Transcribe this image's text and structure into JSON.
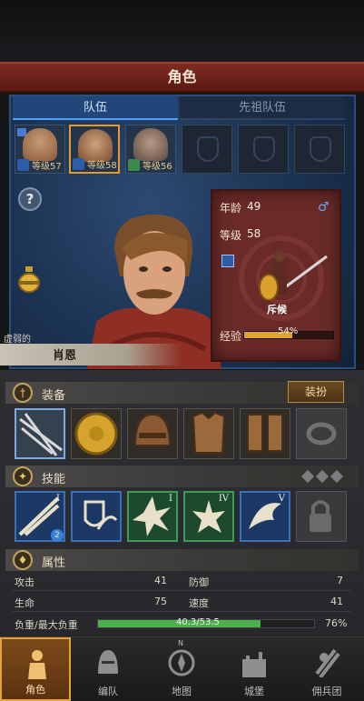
{
  "header": {
    "title": "角色"
  },
  "tabs": {
    "party": "队伍",
    "ancestors": "先祖队伍"
  },
  "party_slots": [
    {
      "level_text": "等级57",
      "class": "sword",
      "flag": true,
      "selected": false
    },
    {
      "level_text": "等级58",
      "class": "sword",
      "flag": false,
      "selected": true
    },
    {
      "level_text": "等级56",
      "class": "green-spear",
      "flag": false,
      "selected": false
    }
  ],
  "hero": {
    "trait": "虚弱的",
    "name": "肖恩",
    "age_label": "年龄",
    "age": "49",
    "level_label": "等级",
    "level": "58",
    "class_name": "斥候",
    "gender_icon": "male-icon",
    "xp_label": "经验",
    "xp_text": "54%",
    "xp_fraction": 0.54
  },
  "equipment": {
    "title": "装备",
    "dress_button": "装扮"
  },
  "skills": {
    "title": "技能",
    "ranks": [
      "I",
      "",
      "I",
      "IV",
      "V"
    ],
    "badge": "2"
  },
  "attributes": {
    "title": "属性",
    "attack_label": "攻击",
    "attack": "41",
    "defense_label": "防御",
    "defense": "7",
    "hp_label": "生命",
    "hp": "75",
    "speed_label": "速度",
    "speed": "41",
    "load_label": "负重/最大负重",
    "load_text": "40.3/53.5",
    "load_pct": "76%",
    "load_fraction": 0.753
  },
  "nav": {
    "character": "角色",
    "formation": "编队",
    "map": "地图",
    "castle": "城堡",
    "mercenary": "佣兵团",
    "map_marker": "N"
  },
  "colors": {
    "accent": "#e7a13a",
    "title_red": "#7e2b22",
    "party_blue": "#22467a"
  }
}
